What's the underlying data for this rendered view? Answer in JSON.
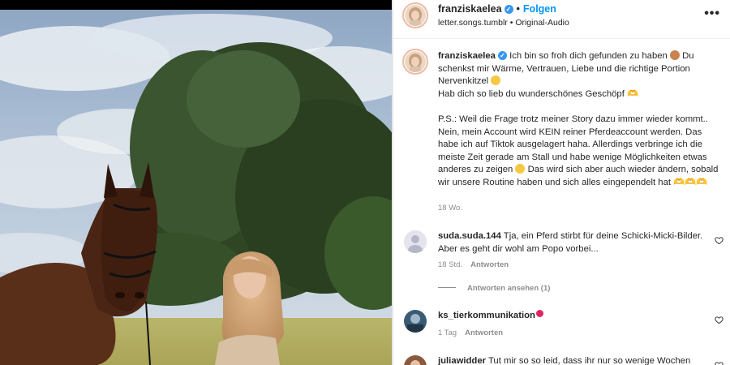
{
  "post": {
    "username": "franziskaelea",
    "follow_label": "Folgen",
    "location": "letter.songs.tumblr",
    "audio": "Original-Audio",
    "more_icon": "more-options-icon"
  },
  "caption": {
    "username": "franziskaelea",
    "line1": "Ich bin so froh dich gefunden zu haben",
    "line1b": "Du schenkst mir Wärme, Vertrauen, Liebe und die richtige Portion Nervenkitzel",
    "line2": "Hab dich so lieb du wunderschönes Geschöpf 🫶",
    "ps": "P.S.: Weil die Frage trotz meiner Story dazu immer wieder kommt.. Nein, mein Account wird KEIN reiner Pferdeaccount werden. Das habe ich auf Tiktok ausgelagert haha. Allerdings verbringe ich die meiste Zeit gerade am Stall und habe wenige Möglichkeiten etwas anderes zu zeigen",
    "ps2": "Das wird sich aber auch wieder ändern, sobald wir unsere Routine haben und sich alles eingependelt hat 🫶🫶🫶",
    "time": "18 Wo."
  },
  "comments": [
    {
      "username": "suda.suda.144",
      "text": "Tja, ein Pferd stirbt für deine Schicki-Micki-Bilder. Aber es geht dir wohl am Popo vorbei...",
      "time": "18 Std.",
      "reply_label": "Antworten",
      "view_replies": "Antworten ansehen (1)"
    },
    {
      "username": "ks_tierkommunikation",
      "text": "",
      "time": "1 Tag",
      "reply_label": "Antworten"
    },
    {
      "username": "juliawidder",
      "text": "Tut mir so so leid, dass ihr nur so wenige Wochen"
    }
  ],
  "colors": {
    "link": "#0095f6",
    "verified": "#3897f0",
    "muted": "#8e8e8e",
    "text": "#262626"
  }
}
